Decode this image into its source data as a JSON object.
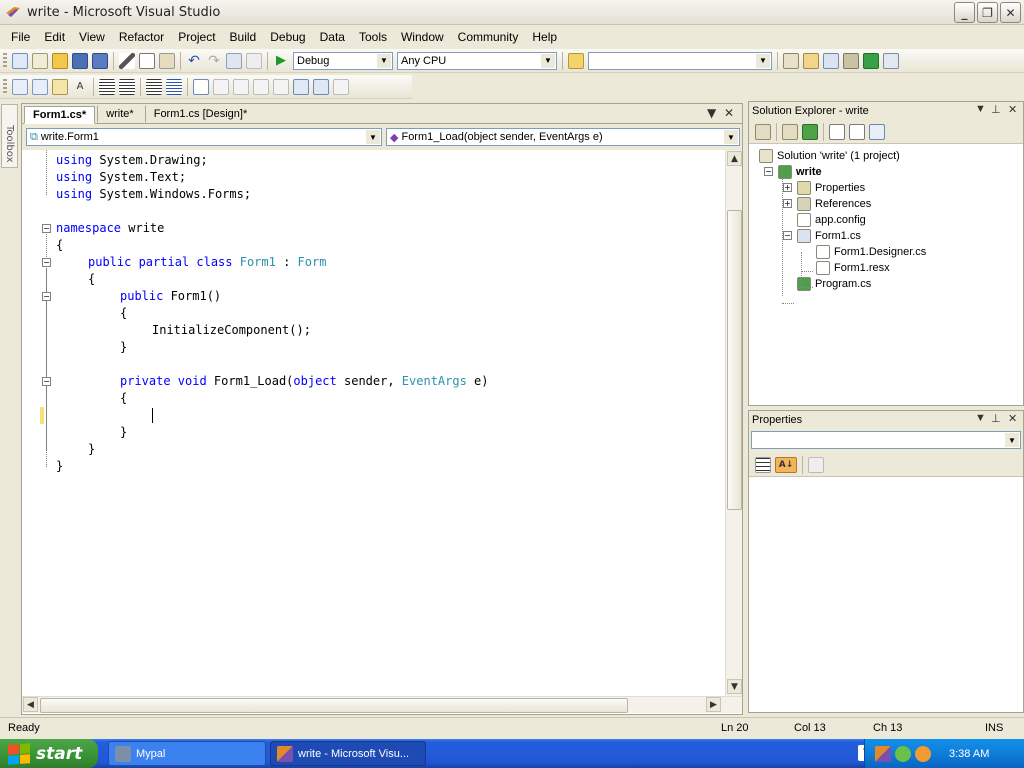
{
  "window": {
    "title": "write - Microsoft Visual Studio",
    "buttons": [
      "_",
      "❐",
      "✕"
    ]
  },
  "menu": [
    "File",
    "Edit",
    "View",
    "Refactor",
    "Project",
    "Build",
    "Debug",
    "Data",
    "Tools",
    "Window",
    "Community",
    "Help"
  ],
  "toolbar": {
    "config": "Debug",
    "platform": "Any CPU",
    "find_value": ""
  },
  "toolbox_label": "Toolbox",
  "editor": {
    "tabs": [
      {
        "label": "Form1.cs*",
        "active": true
      },
      {
        "label": "write*",
        "active": false
      },
      {
        "label": "Form1.cs [Design]*",
        "active": false
      }
    ],
    "type_combo": "write.Form1",
    "member_combo": "Form1_Load(object sender, EventArgs e)",
    "code": [
      {
        "line": 1,
        "indent": 0,
        "parts": [
          [
            "kw",
            "using"
          ],
          [
            "",
            " System.Drawing;"
          ]
        ]
      },
      {
        "line": 2,
        "indent": 0,
        "parts": [
          [
            "kw",
            "using"
          ],
          [
            "",
            " System.Text;"
          ]
        ]
      },
      {
        "line": 3,
        "indent": 0,
        "parts": [
          [
            "kw",
            "using"
          ],
          [
            "",
            " System.Windows.Forms;"
          ]
        ]
      },
      {
        "line": 5,
        "indent": 0,
        "parts": [
          [
            "kw",
            "namespace"
          ],
          [
            "",
            " write"
          ]
        ]
      },
      {
        "line": 6,
        "indent": 0,
        "parts": [
          [
            "",
            "{"
          ]
        ]
      },
      {
        "line": 7,
        "indent": 1,
        "parts": [
          [
            "kw",
            "public partial class"
          ],
          [
            "",
            " "
          ],
          [
            "ty",
            "Form1"
          ],
          [
            "",
            " : "
          ],
          [
            "ty",
            "Form"
          ]
        ]
      },
      {
        "line": 8,
        "indent": 1,
        "parts": [
          [
            "",
            "{"
          ]
        ]
      },
      {
        "line": 9,
        "indent": 2,
        "parts": [
          [
            "kw",
            "public"
          ],
          [
            "",
            " Form1()"
          ]
        ]
      },
      {
        "line": 10,
        "indent": 2,
        "parts": [
          [
            "",
            "{"
          ]
        ]
      },
      {
        "line": 11,
        "indent": 3,
        "parts": [
          [
            "",
            "InitializeComponent();"
          ]
        ]
      },
      {
        "line": 12,
        "indent": 2,
        "parts": [
          [
            "",
            "}"
          ]
        ]
      },
      {
        "line": 14,
        "indent": 2,
        "parts": [
          [
            "kw",
            "private void"
          ],
          [
            "",
            " Form1_Load("
          ],
          [
            "kw",
            "object"
          ],
          [
            "",
            " sender, "
          ],
          [
            "ty",
            "EventArgs"
          ],
          [
            "",
            " e)"
          ]
        ]
      },
      {
        "line": 15,
        "indent": 2,
        "parts": [
          [
            "",
            "{"
          ]
        ]
      },
      {
        "line": 16,
        "indent": 3,
        "parts": [
          [
            "",
            ""
          ]
        ]
      },
      {
        "line": 17,
        "indent": 2,
        "parts": [
          [
            "",
            "}"
          ]
        ]
      },
      {
        "line": 18,
        "indent": 1,
        "parts": [
          [
            "",
            "}"
          ]
        ]
      },
      {
        "line": 19,
        "indent": 0,
        "parts": [
          [
            "",
            "}"
          ]
        ]
      }
    ]
  },
  "solution_explorer": {
    "title": "Solution Explorer - write",
    "items": [
      {
        "label": "Solution 'write' (1 project)",
        "level": 0,
        "bold": false
      },
      {
        "label": "write",
        "level": 1,
        "bold": true
      },
      {
        "label": "Properties",
        "level": 2,
        "bold": false
      },
      {
        "label": "References",
        "level": 2,
        "bold": false
      },
      {
        "label": "app.config",
        "level": 2,
        "bold": false
      },
      {
        "label": "Form1.cs",
        "level": 2,
        "bold": false
      },
      {
        "label": "Form1.Designer.cs",
        "level": 3,
        "bold": false
      },
      {
        "label": "Form1.resx",
        "level": 3,
        "bold": false
      },
      {
        "label": "Program.cs",
        "level": 2,
        "bold": false
      }
    ]
  },
  "properties": {
    "title": "Properties",
    "object_value": ""
  },
  "status": {
    "text": "Ready",
    "ln": "Ln 20",
    "col": "Col 13",
    "ch": "Ch 13",
    "mode": "INS"
  },
  "taskbar": {
    "start": "start",
    "buttons": [
      "Mypal",
      "write - Microsoft Visu..."
    ],
    "clock": "3:38 AM"
  }
}
